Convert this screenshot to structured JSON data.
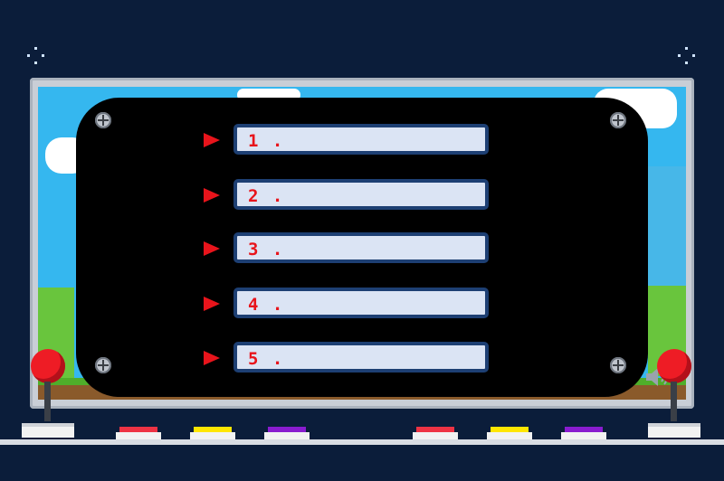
{
  "game": {
    "slots": [
      {
        "label": "1 ."
      },
      {
        "label": "2 ."
      },
      {
        "label": "3 ."
      },
      {
        "label": "4 ."
      },
      {
        "label": "5 ."
      }
    ],
    "colors": {
      "background": "#0b1d3a",
      "panel": "#000000",
      "slot_fill": "#dbe4f4",
      "slot_border": "#1d3f73",
      "label_text": "#e8141b",
      "arrow": "#e8141b",
      "joystick": "#ee1c25",
      "button_red": "#ee3344",
      "button_yellow": "#ffe600",
      "button_purple": "#8a1ccf"
    },
    "icons": {
      "arrow": "triangle-right-icon",
      "speaker": "speaker-icon",
      "screw": "screw-icon",
      "sparkle": "sparkle-icon"
    }
  }
}
